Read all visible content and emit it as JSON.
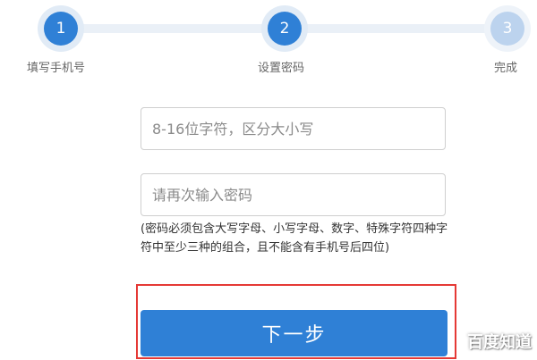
{
  "steps": [
    {
      "number": "1",
      "label": "填写手机号",
      "state": "active"
    },
    {
      "number": "2",
      "label": "设置密码",
      "state": "active"
    },
    {
      "number": "3",
      "label": "完成",
      "state": "inactive"
    }
  ],
  "form": {
    "password_placeholder": "8-16位字符，区分大小写",
    "password_value": "",
    "confirm_placeholder": "请再次输入密码",
    "confirm_value": "",
    "hint": "(密码必须包含大写字母、小写字母、数字、特殊字符四种字符中至少三种的组合，且不能含有手机号后四位)",
    "next_label": "下一步"
  },
  "watermark": "百度知道",
  "colors": {
    "accent": "#2f80d6",
    "inactive_step": "#bcd3ee",
    "highlight": "#e53935"
  }
}
